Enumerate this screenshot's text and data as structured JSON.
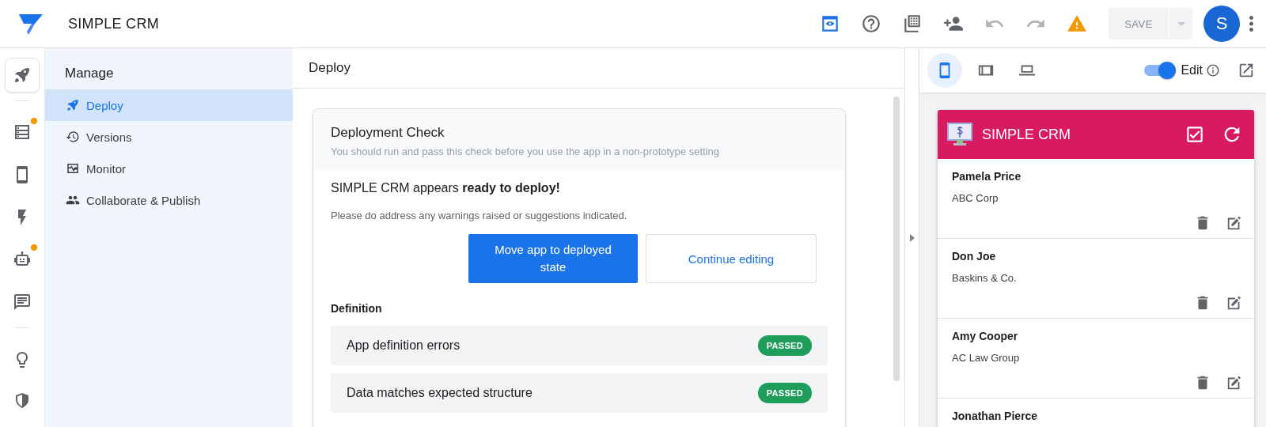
{
  "header": {
    "app_name": "SIMPLE CRM",
    "toolbar": [
      {
        "kind": "preview",
        "active": true,
        "disabled": false
      },
      {
        "kind": "help",
        "active": false,
        "disabled": false
      },
      {
        "kind": "grid",
        "active": false,
        "disabled": false
      },
      {
        "kind": "share",
        "active": false,
        "disabled": false
      },
      {
        "kind": "undo",
        "active": false,
        "disabled": true
      },
      {
        "kind": "redo",
        "active": false,
        "disabled": true
      },
      {
        "kind": "warning",
        "active": false,
        "disabled": false
      }
    ],
    "save_button": {
      "label": "SAVE",
      "disabled": true
    },
    "avatar": {
      "initial": "S"
    }
  },
  "rail": [
    {
      "kind": "deploy",
      "selected": true,
      "badge": false
    },
    {
      "kind": "data",
      "selected": false,
      "badge": true
    },
    {
      "kind": "ux",
      "selected": false,
      "badge": false
    },
    {
      "kind": "actions",
      "selected": false,
      "badge": false
    },
    {
      "kind": "automation",
      "selected": false,
      "badge": true
    },
    {
      "kind": "chat",
      "selected": false,
      "badge": false
    },
    {
      "kind": "ideas",
      "selected": false,
      "badge": false
    },
    {
      "kind": "security",
      "selected": false,
      "badge": false
    }
  ],
  "sidebar": {
    "title": "Manage",
    "items": [
      {
        "kind": "deploy",
        "label": "Deploy",
        "selected": true
      },
      {
        "kind": "versions",
        "label": "Versions",
        "selected": false
      },
      {
        "kind": "monitor",
        "label": "Monitor",
        "selected": false
      },
      {
        "kind": "collaborate",
        "label": "Collaborate & Publish",
        "selected": false
      }
    ]
  },
  "main": {
    "title": "Deploy",
    "card": {
      "title": "Deployment Check",
      "subtitle": "You should run and pass this check before you use the app in a non-prototype setting",
      "status": "SIMPLE CRM appears **ready to deploy!**",
      "note": "Please do address any warnings raised or suggestions indicated.",
      "primary_button": "Move app to deployed state",
      "secondary_button": "Continue editing",
      "section": "Definition",
      "checks": [
        {
          "label": "App definition errors",
          "status": "PASSED",
          "passed": true
        },
        {
          "label": "Data matches expected structure",
          "status": "PASSED",
          "passed": true
        }
      ]
    }
  },
  "preview": {
    "devices": [
      {
        "kind": "phone",
        "selected": true
      },
      {
        "kind": "tablet",
        "selected": false
      },
      {
        "kind": "desktop",
        "selected": false
      }
    ],
    "edit_toggle": {
      "label": "Edit",
      "on": true
    },
    "app": {
      "title": "SIMPLE CRM",
      "items": [
        {
          "name": "Pamela Price",
          "company": "ABC Corp"
        },
        {
          "name": "Don Joe",
          "company": "Baskins & Co."
        },
        {
          "name": "Amy Cooper",
          "company": "AC Law Group"
        },
        {
          "name": "Jonathan Pierce"
        }
      ]
    }
  }
}
